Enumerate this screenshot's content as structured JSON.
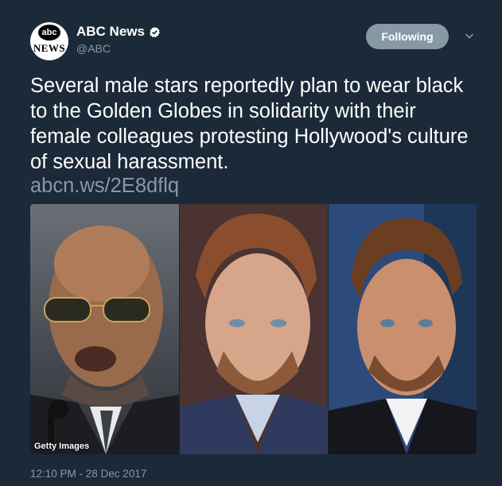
{
  "account": {
    "display_name": "ABC News",
    "handle": "@ABC",
    "avatar_text_top": "abc",
    "avatar_text_bottom": "NEWS",
    "verified": true
  },
  "actions": {
    "follow_label": "Following",
    "menu_icon": "chevron-down-icon"
  },
  "tweet": {
    "text": "Several male stars reportedly plan to wear black to the Golden Globes in solidarity with their female colleagues protesting Hollywood's culture of sexual harassment.",
    "link": "abcn.ws/2E8dflq",
    "timestamp": "12:10 PM - 28 Dec 2017"
  },
  "media": {
    "credit": "Getty Images",
    "panel_count": 3
  },
  "colors": {
    "background": "#1c2938",
    "text_primary": "#ffffff",
    "text_secondary": "#8899a6",
    "button_bg": "#8899a6"
  }
}
